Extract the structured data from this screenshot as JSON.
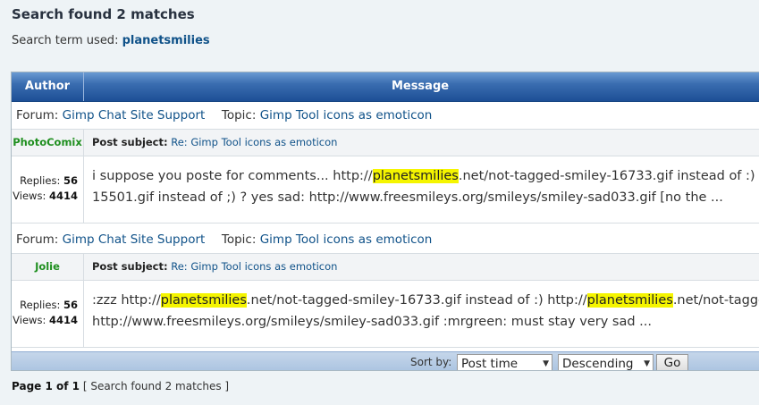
{
  "header": {
    "title": "Search found 2 matches",
    "term_label": "Search term used:",
    "term": "planetsmilies"
  },
  "table": {
    "col_author": "Author",
    "col_message": "Message"
  },
  "labels": {
    "forum": "Forum:",
    "topic": "Topic:",
    "post_subject": "Post subject:",
    "replies": "Replies:",
    "views": "Views:"
  },
  "results": [
    {
      "forum": "Gimp Chat Site Support",
      "topic": "Gimp Tool icons as emoticon",
      "author": "PhotoComix",
      "subject": "Re: Gimp Tool icons as emoticon",
      "replies": "56",
      "views": "4414",
      "line1_pre": "i suppose you poste for comments... http://",
      "line1_hl": "planetsmilies",
      "line1_post": ".net/not-tagged-smiley-16733.gif instead of :)",
      "line2": "15501.gif instead of ;) ? yes sad: http://www.freesmileys.org/smileys/smiley-sad033.gif [no the ..."
    },
    {
      "forum": "Gimp Chat Site Support",
      "topic": "Gimp Tool icons as emoticon",
      "author": "Jolie",
      "subject": "Re: Gimp Tool icons as emoticon",
      "replies": "56",
      "views": "4414",
      "line1_pre": ":zzz http://",
      "line1_hl": "planetsmilies",
      "line1_mid": ".net/not-tagged-smiley-16733.gif instead of :) http://",
      "line1_hl2": "planetsmilies",
      "line1_post": ".net/not-tagge",
      "line2": "http://www.freesmileys.org/smileys/smiley-sad033.gif :mrgreen: must stay very sad ..."
    }
  ],
  "sort": {
    "label": "Sort by:",
    "field": "Post time",
    "direction": "Descending",
    "go": "Go"
  },
  "pagination": {
    "page": "Page 1 of 1",
    "summary": "[ Search found 2 matches ]"
  },
  "colors": {
    "link": "#105289",
    "author": "#1f8f1f",
    "highlight": "#f5f500",
    "header_blue": "#1d4f96"
  }
}
